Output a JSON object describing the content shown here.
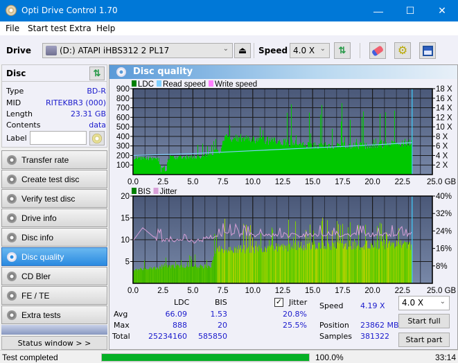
{
  "window": {
    "title": "Opti Drive Control 1.70",
    "minimize_glyph": "—",
    "maximize_glyph": "☐",
    "close_glyph": "✕"
  },
  "menu": [
    "File",
    "Start test",
    "Extra",
    "Help"
  ],
  "toolbar": {
    "drive_label": "Drive",
    "drive_value": "(D:)  ATAPI iHBS312  2 PL17",
    "speed_label": "Speed",
    "speed_value": "4.0 X"
  },
  "disc": {
    "header": "Disc",
    "rows": [
      {
        "key": "Type",
        "value": "BD-R"
      },
      {
        "key": "MID",
        "value": "RITEKBR3 (000)"
      },
      {
        "key": "Length",
        "value": "23.31 GB"
      },
      {
        "key": "Contents",
        "value": "data"
      }
    ],
    "label_key": "Label",
    "label_value": ""
  },
  "nav": [
    {
      "label": "Transfer rate",
      "active": false
    },
    {
      "label": "Create test disc",
      "active": false
    },
    {
      "label": "Verify test disc",
      "active": false
    },
    {
      "label": "Drive info",
      "active": false
    },
    {
      "label": "Disc info",
      "active": false
    },
    {
      "label": "Disc quality",
      "active": true
    },
    {
      "label": "CD Bler",
      "active": false
    },
    {
      "label": "FE / TE",
      "active": false
    },
    {
      "label": "Extra tests",
      "active": false
    }
  ],
  "status_window_label": "Status window > >",
  "panel_title": "Disc quality",
  "colors": {
    "ldc": "#00c800",
    "read_speed": "#80d0ff",
    "write_speed": "#ff80ff",
    "bis": "#00a000",
    "jitter": "#d8a0d8",
    "plot_bg_top": "#4a5878",
    "plot_bg_bottom": "#7888a8",
    "accent": "#0078d7",
    "progress": "#06b025"
  },
  "chart_data": [
    {
      "type": "bar",
      "title": "LDC / Read speed",
      "legend": [
        "LDC",
        "Read speed",
        "Write speed"
      ],
      "xlabel": "GB",
      "x_ticks": [
        "0.0",
        "2.5",
        "5.0",
        "7.5",
        "10.0",
        "12.5",
        "15.0",
        "17.5",
        "20.0",
        "22.5",
        "25.0 GB"
      ],
      "xlim": [
        0,
        25
      ],
      "y_ticks": [
        "100",
        "200",
        "300",
        "400",
        "500",
        "600",
        "700",
        "800",
        "900"
      ],
      "ylim": [
        0,
        900
      ],
      "y2_ticks": [
        "2 X",
        "4 X",
        "6 X",
        "8 X",
        "10 X",
        "12 X",
        "14 X",
        "16 X",
        "18 X"
      ],
      "y2lim": [
        0,
        18
      ],
      "ldc_profile": [
        {
          "x": 0.0,
          "base": 180,
          "peak": 210
        },
        {
          "x": 2.0,
          "base": 170,
          "peak": 180
        },
        {
          "x": 2.4,
          "base": 60,
          "peak": 160
        },
        {
          "x": 3.0,
          "base": 180,
          "peak": 200
        },
        {
          "x": 5.5,
          "base": 190,
          "peak": 330
        },
        {
          "x": 7.3,
          "base": 260,
          "peak": 400
        },
        {
          "x": 7.6,
          "base": 400,
          "peak": 640
        },
        {
          "x": 10.0,
          "base": 380,
          "peak": 650
        },
        {
          "x": 15.0,
          "base": 310,
          "peak": 880
        },
        {
          "x": 20.0,
          "base": 310,
          "peak": 620
        },
        {
          "x": 23.3,
          "base": 350,
          "peak": 720
        }
      ],
      "read_speed": [
        {
          "x": 0.0,
          "y": 4.0
        },
        {
          "x": 5.0,
          "y": 4.4
        },
        {
          "x": 10.0,
          "y": 5.0
        },
        {
          "x": 15.0,
          "y": 5.6
        },
        {
          "x": 20.0,
          "y": 6.2
        },
        {
          "x": 23.3,
          "y": 6.7
        }
      ],
      "end_marker_x": 23.31
    },
    {
      "type": "bar",
      "title": "BIS / Jitter",
      "legend": [
        "BIS",
        "Jitter"
      ],
      "xlabel": "GB",
      "x_ticks": [
        "0.0",
        "2.5",
        "5.0",
        "7.5",
        "10.0",
        "12.5",
        "15.0",
        "17.5",
        "20.0",
        "22.5",
        "25.0 GB"
      ],
      "xlim": [
        0,
        25
      ],
      "y_ticks": [
        "5",
        "10",
        "15",
        "20"
      ],
      "ylim": [
        0,
        20
      ],
      "y2_ticks": [
        "8%",
        "16%",
        "24%",
        "32%",
        "40%"
      ],
      "y2lim": [
        0,
        40
      ],
      "bis_profile": [
        {
          "x": 0.0,
          "base": 3,
          "peak": 5
        },
        {
          "x": 3.0,
          "base": 4,
          "peak": 6
        },
        {
          "x": 6.5,
          "base": 4,
          "peak": 7
        },
        {
          "x": 7.0,
          "base": 8,
          "peak": 15
        },
        {
          "x": 10.0,
          "base": 8,
          "peak": 14
        },
        {
          "x": 15.0,
          "base": 9,
          "peak": 15
        },
        {
          "x": 20.0,
          "base": 9,
          "peak": 15
        },
        {
          "x": 23.3,
          "base": 9,
          "peak": 12
        }
      ],
      "jitter_profile": [
        {
          "x": 0.0,
          "y": 19.5
        },
        {
          "x": 0.8,
          "y": 25.5
        },
        {
          "x": 2.0,
          "y": 20.0
        },
        {
          "x": 5.0,
          "y": 19.0
        },
        {
          "x": 7.5,
          "y": 22.5
        },
        {
          "x": 12.5,
          "y": 22.0
        },
        {
          "x": 23.3,
          "y": 22.5
        }
      ],
      "end_marker_x": 23.31
    }
  ],
  "stats": {
    "col_ldc": "LDC",
    "col_bis": "BIS",
    "jitter_label": "Jitter",
    "jitter_checked": true,
    "rows": [
      {
        "label": "Avg",
        "ldc": "66.09",
        "bis": "1.53",
        "jitter": "20.8%"
      },
      {
        "label": "Max",
        "ldc": "888",
        "bis": "20",
        "jitter": "25.5%"
      },
      {
        "label": "Total",
        "ldc": "25234160",
        "bis": "585850",
        "jitter": ""
      }
    ],
    "speed_label": "Speed",
    "speed_value": "4.19 X",
    "position_label": "Position",
    "position_value": "23862 MB",
    "samples_label": "Samples",
    "samples_value": "381322",
    "speed_select": "4.0 X",
    "start_full": "Start full",
    "start_part": "Start part"
  },
  "statusbar": {
    "text": "Test completed",
    "progress_fraction": 1.0,
    "progress_text": "100.0%",
    "time": "33:14"
  }
}
